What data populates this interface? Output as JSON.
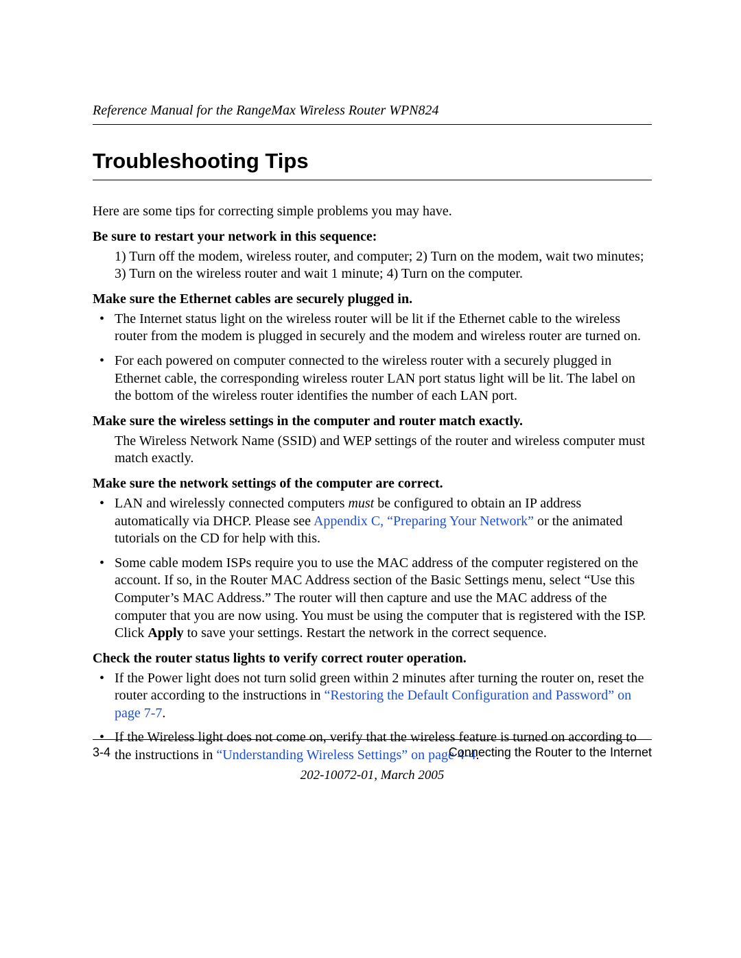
{
  "header": {
    "running_head": "Reference Manual for the RangeMax Wireless Router WPN824"
  },
  "title": "Troubleshooting Tips",
  "intro": "Here are some tips for correcting simple problems you may have.",
  "sections": {
    "restart": {
      "heading": "Be sure to restart your network in this sequence:",
      "body": "1) Turn off the modem, wireless router, and computer; 2) Turn on the modem, wait two minutes; 3) Turn on the wireless router and wait 1 minute; 4) Turn on the computer."
    },
    "ethernet": {
      "heading": "Make sure the Ethernet cables are securely plugged in.",
      "bullets": [
        "The Internet status light on the wireless router will be lit if the Ethernet cable to the wireless router from the modem is plugged in securely and the modem and wireless router are turned on.",
        "For each powered on computer connected to the wireless router with a securely plugged in Ethernet cable, the corresponding wireless router LAN port status light will be lit. The label on the bottom of the wireless router identifies the number of each LAN port."
      ]
    },
    "wireless": {
      "heading": "Make sure the wireless settings in the computer and router match exactly.",
      "body": "The Wireless Network Name (SSID) and WEP settings of the router and wireless computer must match exactly."
    },
    "network": {
      "heading": "Make sure the network settings of the computer are correct.",
      "bullet1_pre": "LAN and wirelessly connected computers ",
      "bullet1_must": "must",
      "bullet1_mid": " be configured to obtain an IP address automatically via DHCP. Please see ",
      "bullet1_link": "Appendix C, “Preparing Your Network”",
      "bullet1_post": " or the animated tutorials on the CD for help with this.",
      "bullet2_pre": "Some cable modem ISPs require you to use the MAC address of the computer registered on the account. If so, in the Router MAC Address section of the Basic Settings menu, select “Use this Computer’s MAC Address.” The router will then capture and use the MAC address of the computer that you are now using. You must be using the computer that is registered with the ISP. Click ",
      "bullet2_bold": "Apply",
      "bullet2_post": " to save your settings. Restart the network in the correct sequence."
    },
    "status": {
      "heading": "Check the router status lights to verify correct router operation.",
      "bullet1_pre": "If the Power light does not turn solid green within 2 minutes after turning the router on, reset the router according to the instructions in ",
      "bullet1_link": "“Restoring the Default Configuration and Password” on page 7-7",
      "bullet1_post": ".",
      "bullet2_pre": "If the Wireless light does not come on, verify that the wireless feature is turned on according to the instructions in ",
      "bullet2_link": "“Understanding Wireless Settings” on page 4-4",
      "bullet2_post": "."
    }
  },
  "footer": {
    "page_number": "3-4",
    "chapter": "Connecting the Router to the Internet",
    "doc_version": "202-10072-01, March 2005"
  }
}
